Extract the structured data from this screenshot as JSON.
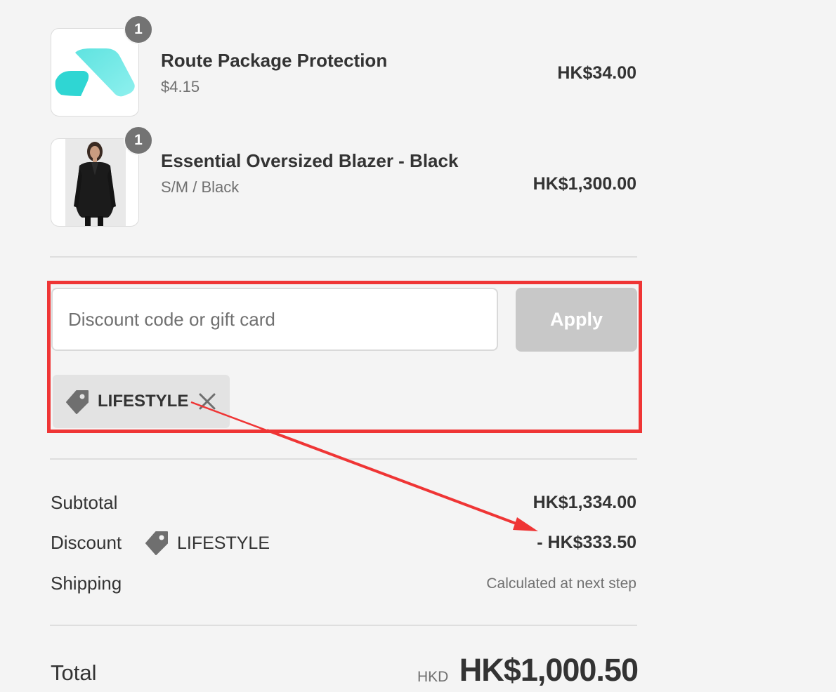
{
  "line_items": [
    {
      "quantity": "1",
      "name": "Route Package Protection",
      "subtitle": "$4.15",
      "price": "HK$34.00",
      "thumbnail_icon": "route-logo-icon"
    },
    {
      "quantity": "1",
      "name": "Essential Oversized Blazer - Black",
      "subtitle": "S/M / Black",
      "price": "HK$1,300.00",
      "thumbnail_icon": "blazer-photo"
    }
  ],
  "discount": {
    "placeholder": "Discount code or gift card",
    "value": "",
    "apply_label": "Apply",
    "applied_code": "LIFESTYLE",
    "chip_icon": "tag-icon",
    "remove_icon": "close-icon"
  },
  "summary": {
    "subtotal_label": "Subtotal",
    "subtotal_value": "HK$1,334.00",
    "discount_label": "Discount",
    "discount_code": "LIFESTYLE",
    "discount_value": "- HK$333.50",
    "shipping_label": "Shipping",
    "shipping_value": "Calculated at next step",
    "total_label": "Total",
    "currency": "HKD",
    "total_value": "HK$1,000.50"
  },
  "annotation": {
    "highlight_color": "#ef3535"
  },
  "colors": {
    "background": "#f4f4f4",
    "text": "#333333",
    "muted_text": "#707070",
    "apply_button": "#c8c8c8",
    "quantity_badge": "#737373",
    "route_logo": "#5ee0e0"
  }
}
